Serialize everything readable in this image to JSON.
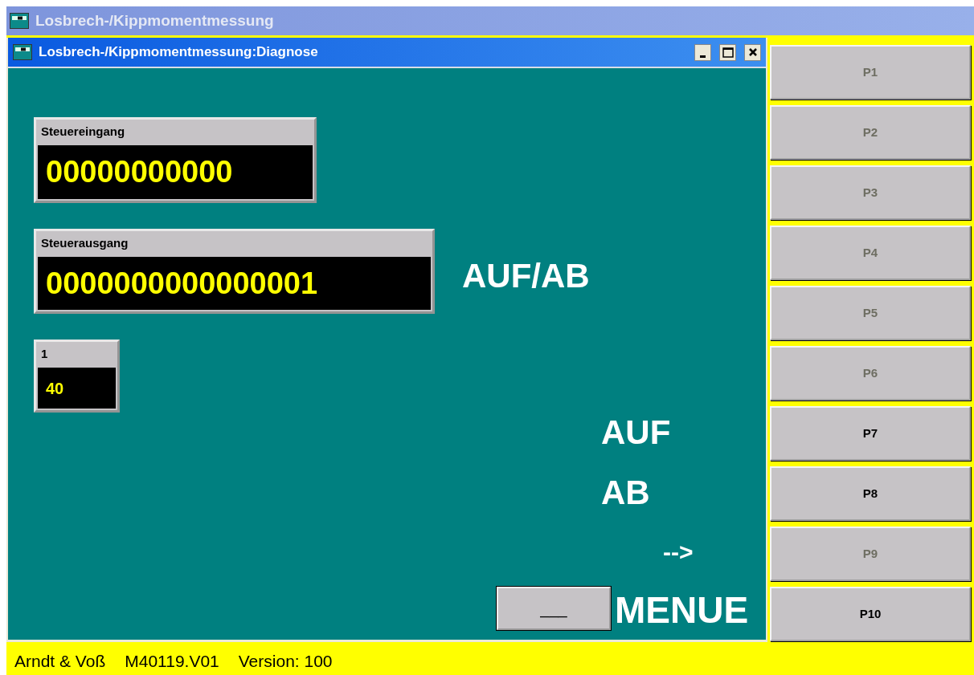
{
  "app_window": {
    "title": "Losbrech-/Kippmomentmessung"
  },
  "dialog": {
    "title": "Losbrech-/Kippmomentmessung:Diagnose"
  },
  "displays": [
    {
      "label": "Steuereingang",
      "value": "00000000000"
    },
    {
      "label": "Steuerausgang",
      "value": "0000000000000001"
    },
    {
      "label": "1",
      "value": "40"
    }
  ],
  "labels": [
    {
      "text": "AUF/AB",
      "kind": "large"
    },
    {
      "text": "AUF",
      "kind": "large"
    },
    {
      "text": "AB",
      "kind": "large"
    },
    {
      "text": "-->",
      "kind": "arrow"
    }
  ],
  "menu_button": {
    "label": "___"
  },
  "menu_label": "MENUE",
  "function_keys": [
    {
      "label": "P1",
      "disabled": true
    },
    {
      "label": "P2",
      "disabled": true
    },
    {
      "label": "P3",
      "disabled": true
    },
    {
      "label": "P4",
      "disabled": true
    },
    {
      "label": "P5",
      "disabled": true
    },
    {
      "label": "P6",
      "disabled": true
    },
    {
      "label": "P7",
      "disabled": false
    },
    {
      "label": "P8",
      "disabled": false
    },
    {
      "label": "P9",
      "disabled": true
    },
    {
      "label": "P10",
      "disabled": false
    }
  ],
  "status_bar": [
    "Arndt & Voß",
    "M40119.V01",
    "Version: 100"
  ]
}
